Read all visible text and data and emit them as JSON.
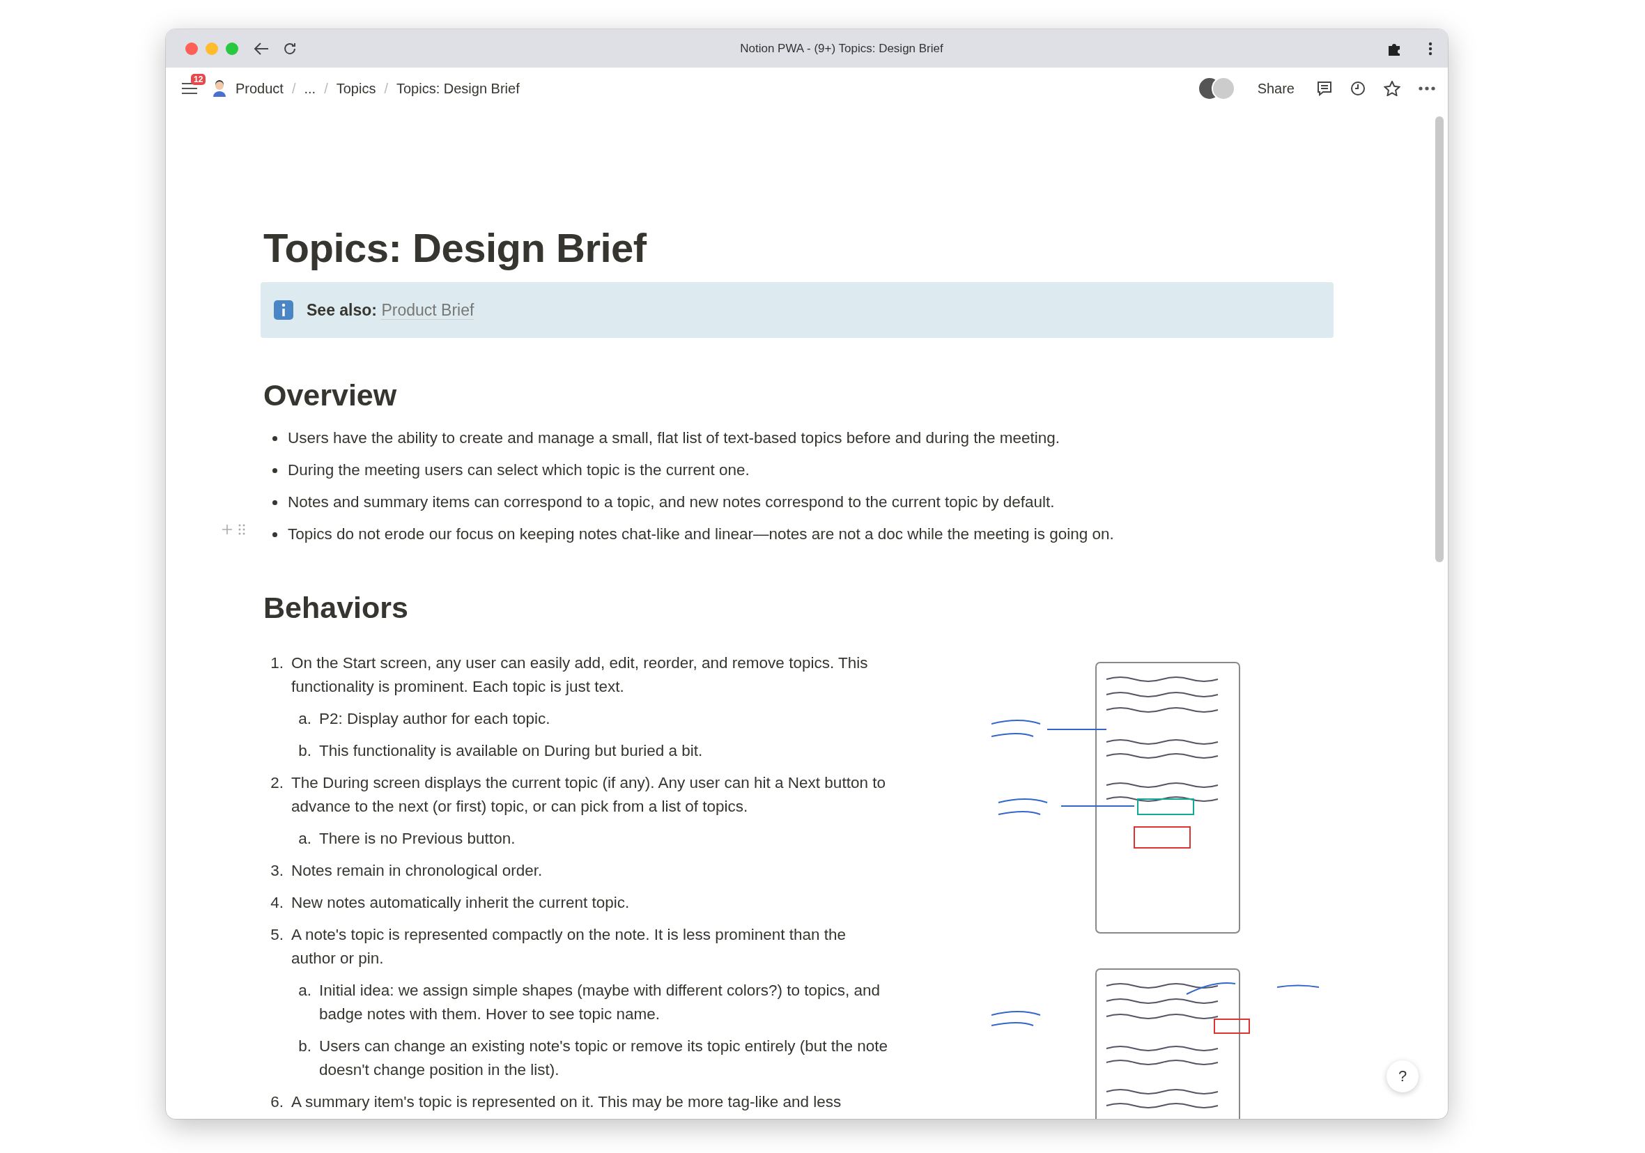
{
  "window": {
    "title": "Notion PWA - (9+) Topics: Design Brief"
  },
  "topbar": {
    "notification_count": "12",
    "breadcrumbs": [
      "Product",
      "...",
      "Topics",
      "Topics: Design Brief"
    ],
    "separator": "/",
    "share": "Share"
  },
  "page": {
    "title": "Topics: Design Brief",
    "callout": {
      "label": "See also:",
      "link": "Product Brief"
    },
    "sections": [
      {
        "heading": "Overview",
        "kind": "bulleted",
        "items": [
          {
            "text": "Users have the ability to create and manage a small, flat list of text-based topics before and during the meeting."
          },
          {
            "text": "During the meeting users can select which topic is the current one."
          },
          {
            "text": "Notes and summary items can correspond to a topic, and new notes correspond to the current topic by default."
          },
          {
            "text": "Topics do not erode our focus on keeping notes chat-like and linear—notes are not a doc while the meeting is going on."
          }
        ]
      },
      {
        "heading": "Behaviors",
        "kind": "numbered",
        "items": [
          {
            "marker": "1.",
            "text": "On the Start screen, any user can easily add, edit, reorder, and remove topics. This functionality is prominent. Each topic is just text.",
            "children": [
              {
                "marker": "a.",
                "text": "P2: Display author for each topic."
              },
              {
                "marker": "b.",
                "text": "This functionality is available on During but buried a bit."
              }
            ]
          },
          {
            "marker": "2.",
            "text": "The During screen displays the current topic (if any). Any user can hit a Next button to advance to the next (or first) topic, or can pick from a list of topics.",
            "children": [
              {
                "marker": "a.",
                "text": "There is no Previous button."
              }
            ]
          },
          {
            "marker": "3.",
            "text": "Notes remain in chronological order."
          },
          {
            "marker": "4.",
            "text": "New notes automatically inherit the current topic."
          },
          {
            "marker": "5.",
            "text": "A note's topic is represented compactly on the note. It is less prominent than the author or pin.",
            "children": [
              {
                "marker": "a.",
                "text": "Initial idea: we assign simple shapes (maybe with different colors?) to topics, and badge notes with them. Hover to see topic name."
              },
              {
                "marker": "b.",
                "text": "Users can change an existing note's topic or remove its topic entirely (but the note doesn't change position in the list)."
              }
            ]
          },
          {
            "marker": "6.",
            "text": "A summary item's topic is represented on it. This may be more tag-like and less"
          }
        ]
      }
    ]
  },
  "help": "?"
}
